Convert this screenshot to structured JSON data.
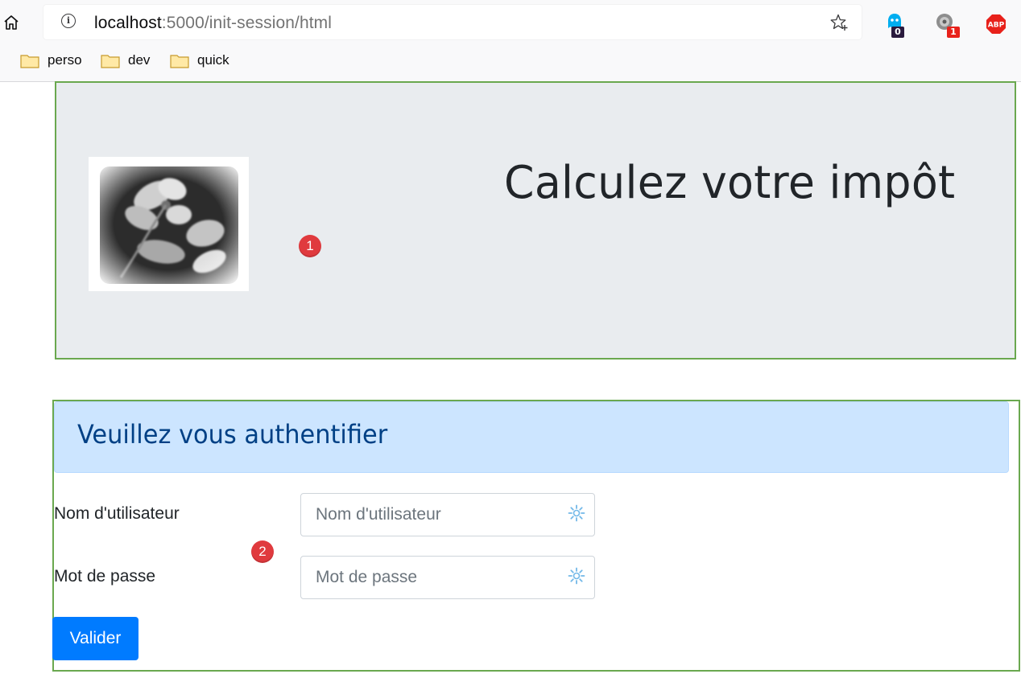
{
  "browser": {
    "url_host": "localhost",
    "url_path": ":5000/init-session/html",
    "extensions": [
      {
        "name": "ghostery-icon",
        "badge": "0"
      },
      {
        "name": "extension-icon",
        "badge": "1"
      },
      {
        "name": "adblock-plus-icon",
        "label": "ABP"
      }
    ],
    "bookmarks": [
      {
        "label": "perso"
      },
      {
        "label": "dev"
      },
      {
        "label": "quick"
      }
    ]
  },
  "header": {
    "title": "Calculez votre impôt",
    "logo_icon": "flower-photo"
  },
  "callouts": [
    "1",
    "2"
  ],
  "auth": {
    "heading": "Veuillez vous authentifier",
    "username_label": "Nom d'utilisateur",
    "username_placeholder": "Nom d'utilisateur",
    "username_value": "",
    "password_label": "Mot de passe",
    "password_placeholder": "Mot de passe",
    "password_value": "",
    "submit_label": "Valider"
  },
  "colors": {
    "jumbotron_bg": "#e9ecef",
    "alert_bg": "#cce5ff",
    "alert_text": "#004085",
    "primary": "#007bff",
    "callout": "#e03a3e",
    "annotation_border": "#6aa84f"
  }
}
